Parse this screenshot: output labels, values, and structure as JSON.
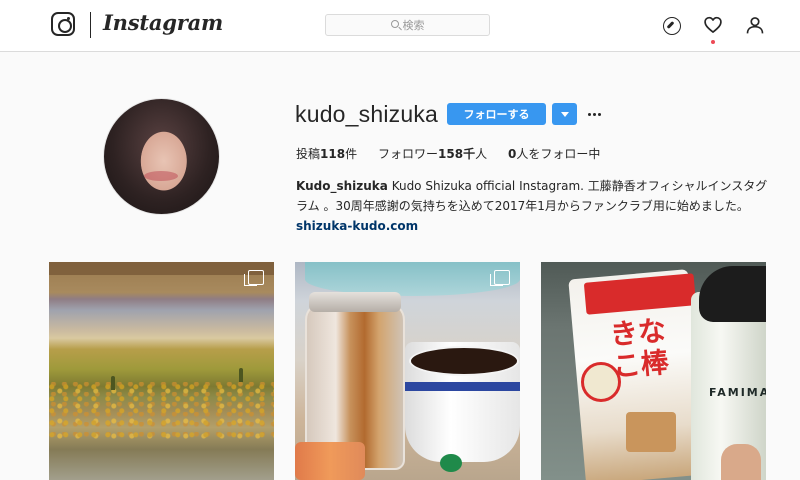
{
  "topnav": {
    "wordmark": "Instagram",
    "search_placeholder": "検索"
  },
  "profile": {
    "username": "kudo_shizuka",
    "follow_label": "フォローする",
    "stats": {
      "posts_label": "投稿",
      "posts_value": "118",
      "posts_unit": "件",
      "followers_label": "フォロワー",
      "followers_value": "158千",
      "followers_unit": "人",
      "following_value": "0",
      "following_label": "人をフォロー中"
    },
    "bio": {
      "name": "Kudo_shizuka",
      "text": " Kudo Shizuka official Instagram. 工藤静香オフィシャルインスタグラム 。30周年感謝の気持ちを込めて2017年1月からファンクラブ用に始めました。",
      "link": "shizuka-kudo.com"
    }
  },
  "posts": {
    "p3_packaging_text": "きなこ棒",
    "p3_cup_text": "FAMIMA"
  },
  "colors": {
    "accent": "#3897f0",
    "notification": "#ed4956",
    "link": "#003569"
  },
  "icons": [
    "instagram-logo-icon",
    "search-icon",
    "explore-compass-icon",
    "heart-icon",
    "profile-icon",
    "dropdown-caret-icon",
    "more-options-icon",
    "multiple-photos-icon"
  ]
}
